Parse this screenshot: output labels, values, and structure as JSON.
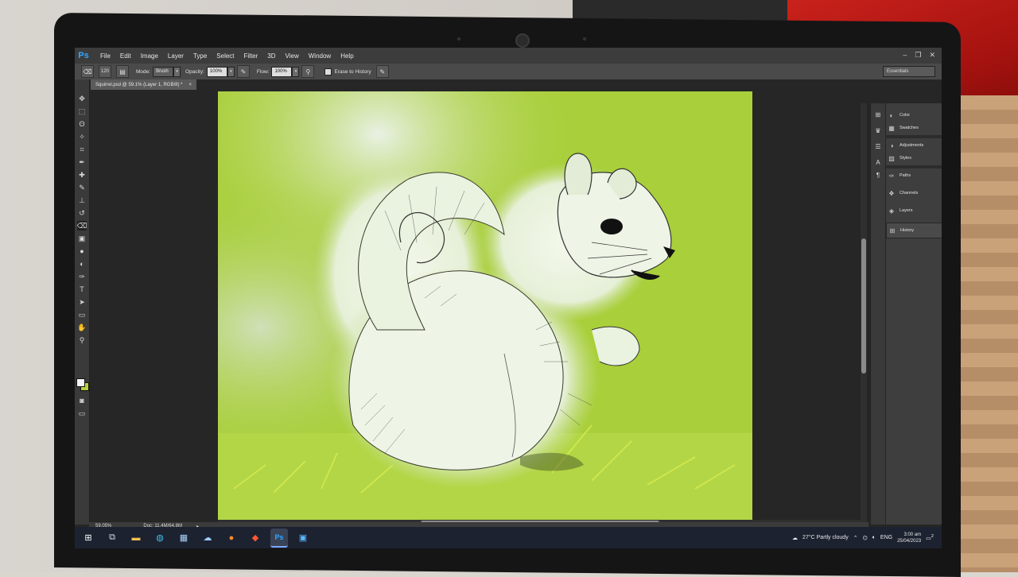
{
  "app": {
    "logo": "Ps",
    "menu": [
      "File",
      "Edit",
      "Image",
      "Layer",
      "Type",
      "Select",
      "Filter",
      "3D",
      "View",
      "Window",
      "Help"
    ],
    "window_controls": [
      "–",
      "❐",
      "✕"
    ]
  },
  "options_bar": {
    "mode_label": "Mode:",
    "mode_value": "Brush",
    "opacity_label": "Opacity:",
    "opacity_value": "100%",
    "flow_label": "Flow:",
    "flow_value": "100%",
    "erase_history_label": "Erase to History",
    "brush_size": "120",
    "workspace": "Essentials"
  },
  "document": {
    "tab_title": "Squirrel.psd @ 59.1% (Layer 1, RGB/8) *",
    "tab_close": "×"
  },
  "status": {
    "zoom": "59.05%",
    "doc_size": "Doc: 11.4M/64.8M"
  },
  "panels": {
    "items": [
      "Color",
      "Swatches",
      "Adjustments",
      "Styles",
      "Paths",
      "Channels",
      "Layers",
      "History"
    ]
  },
  "colors": {
    "ps_blue": "#31a8ff",
    "foreground": "#f4f4f4",
    "background": "#b6d23a",
    "canvas_green": "#a9cf3a"
  },
  "taskbar": {
    "weather": "27°C  Partly cloudy",
    "language": "ENG",
    "time": "3:00 am",
    "date": "25/04/2023",
    "notifications": "2"
  }
}
